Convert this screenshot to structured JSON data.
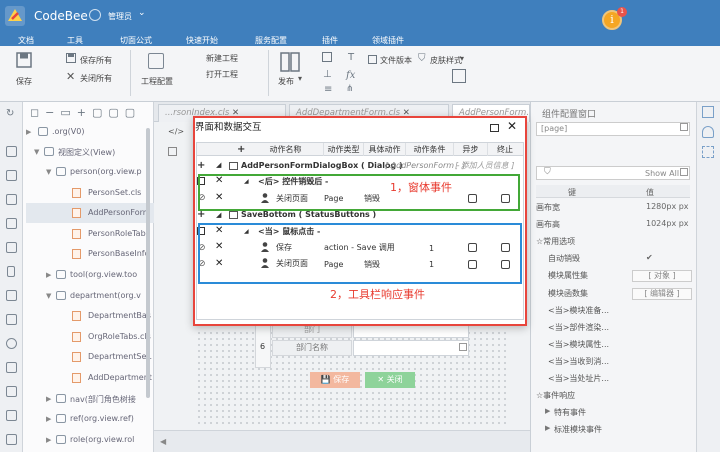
{
  "app": {
    "brand": "CodeBee",
    "user": "管理员",
    "notifications": "1"
  },
  "menu": [
    "文档",
    "工具",
    "切面公式",
    "快速开始",
    "服务配置",
    "插件",
    "领域插件"
  ],
  "ribbon": {
    "save": "保存",
    "save_all": "保存所有",
    "close_all": "关闭所有",
    "project_config": "工程配置",
    "new_project": "新建工程",
    "open_project": "打开工程",
    "publish": "发布",
    "file_version": "文件版本",
    "skin_style": "皮肤样式"
  },
  "tree": {
    "root": ".org(V0)",
    "view_def": "视图定义(View)",
    "items": [
      {
        "label": "person(org.view.p",
        "kind": "pkg"
      },
      {
        "label": "PersonSet.cls",
        "kind": "file"
      },
      {
        "label": "AddPersonForm",
        "kind": "file"
      },
      {
        "label": "PersonRoleTabs",
        "kind": "file"
      },
      {
        "label": "PersonBaseInfo",
        "kind": "file"
      },
      {
        "label": "tool(org.view.too",
        "kind": "pkg"
      },
      {
        "label": "department(org.v",
        "kind": "pkg"
      },
      {
        "label": "DepartmentBas",
        "kind": "file"
      },
      {
        "label": "OrgRoleTabs.cls",
        "kind": "file"
      },
      {
        "label": "DepartmentSet.",
        "kind": "file"
      },
      {
        "label": "AddDepartment",
        "kind": "file"
      },
      {
        "label": "nav(部门角色树接",
        "kind": "pkg"
      },
      {
        "label": "ref(org.view.ref)",
        "kind": "pkg"
      },
      {
        "label": "role(org.view.rol",
        "kind": "pkg"
      }
    ]
  },
  "tabs": [
    "...rsonIndex.cls",
    "AddDepartmentForm.cls",
    "AddPersonForm.cls"
  ],
  "dialog": {
    "title": "界面和数据交互",
    "headers": [
      "动作名称",
      "动作类型",
      "具体动作",
      "动作条件",
      "异步",
      "终止"
    ],
    "group1": {
      "name": "AddPersonFormDialogBox",
      "type": "( Dialog )",
      "path": "[ AddPersonForm - ]",
      "extra": "[ 添加人员信息 ]"
    },
    "event1": {
      "when": "<后>",
      "label": "控件销毁后 -"
    },
    "row1": {
      "name": "关闭页面",
      "type": "Page",
      "action": "销毁"
    },
    "group2": {
      "name": "SaveBottom",
      "type": "( StatusButtons )"
    },
    "event2": {
      "when": "<当>",
      "label": "鼠标点击 -"
    },
    "row2": {
      "name": "保存",
      "type": "action - Save 调用",
      "cond": "1"
    },
    "row3": {
      "name": "关闭页面",
      "type": "Page",
      "action": "销毁",
      "cond": "1"
    },
    "annot1": "1，窗体事件",
    "annot2": "2，工具栏响应事件"
  },
  "form": {
    "row_num": "6",
    "dept_name": "部门名称",
    "save": "保存",
    "close": "关闭",
    "partial": "部门"
  },
  "panel": {
    "title": "组件配置窗口",
    "search_value": "[page]",
    "show_all": "Show All",
    "col_key": "键",
    "col_val": "值",
    "rows": [
      {
        "k": "画布宽",
        "v": "1280px px"
      },
      {
        "k": "画布高",
        "v": "1024px px"
      },
      {
        "k": "☆常用选项",
        "v": ""
      },
      {
        "k": "自动销毁",
        "v": "✔"
      },
      {
        "k": "模块属性集",
        "v": "[ 对象 ]"
      },
      {
        "k": "模块函数集",
        "v": "[ 编辑器 ]"
      },
      {
        "k": "<当>模块准备...",
        "v": ""
      },
      {
        "k": "<当>部件渲染...",
        "v": ""
      },
      {
        "k": "<当>模块属性...",
        "v": ""
      },
      {
        "k": "<当>当收到消...",
        "v": ""
      },
      {
        "k": "<当>当处址片...",
        "v": ""
      },
      {
        "k": "☆事件响应",
        "v": ""
      },
      {
        "k": "特有事件",
        "v": ""
      },
      {
        "k": "标准模块事件",
        "v": ""
      }
    ]
  }
}
